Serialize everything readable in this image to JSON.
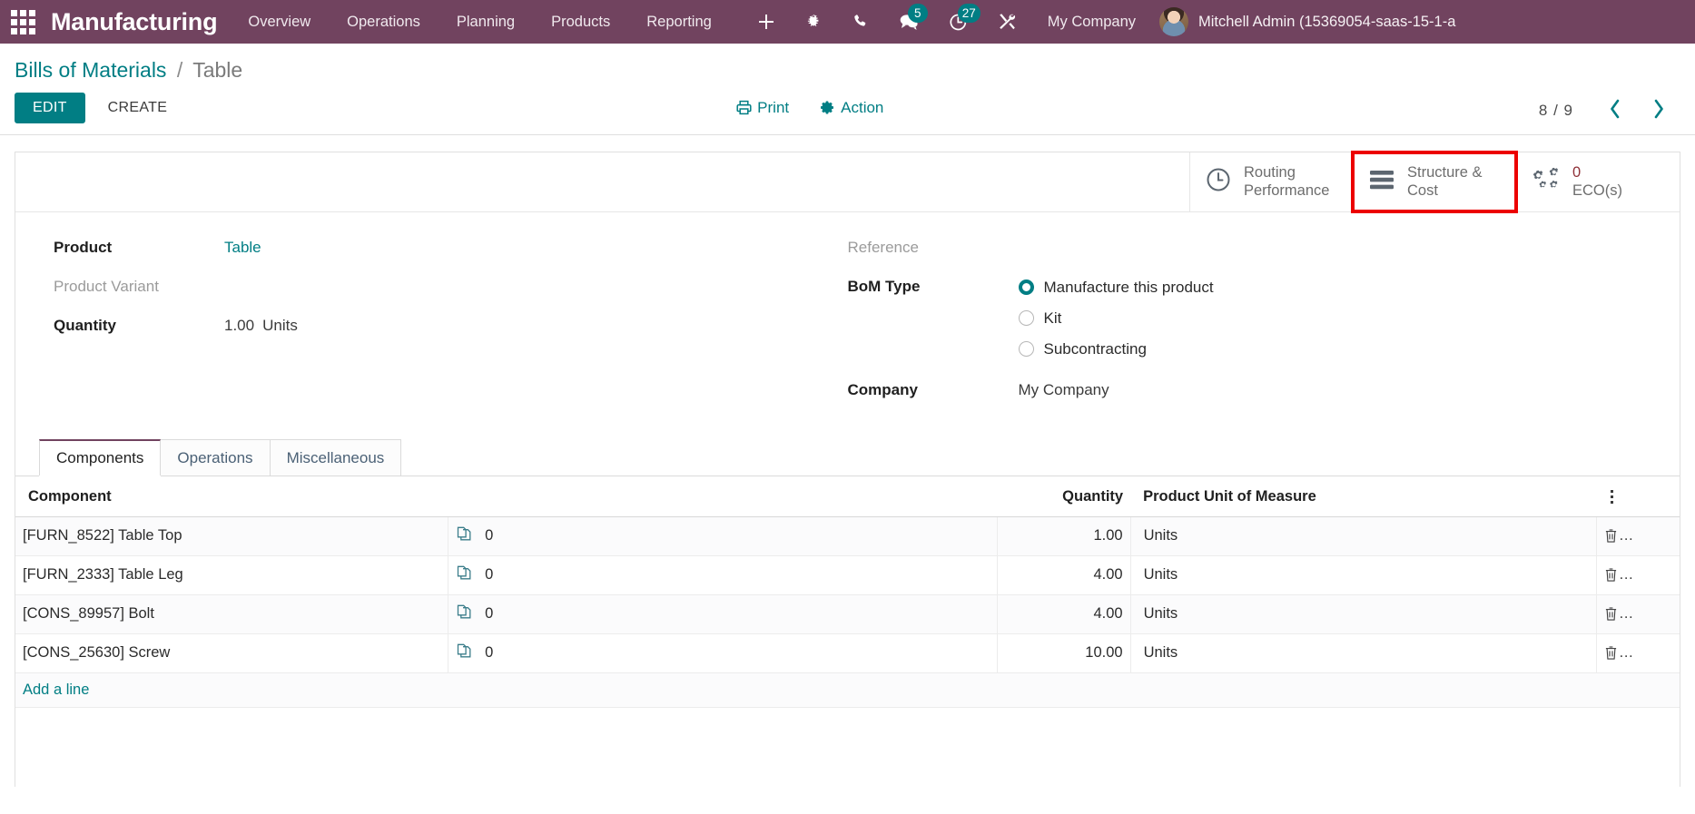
{
  "navbar": {
    "apps_icon": "apps-grid-icon",
    "brand": "Manufacturing",
    "menu": [
      {
        "label": "Overview"
      },
      {
        "label": "Operations"
      },
      {
        "label": "Planning"
      },
      {
        "label": "Products"
      },
      {
        "label": "Reporting"
      }
    ],
    "icons": [
      {
        "name": "plus-icon",
        "badge": ""
      },
      {
        "name": "bug-icon",
        "badge": ""
      },
      {
        "name": "phone-icon",
        "badge": ""
      },
      {
        "name": "chat-icon",
        "badge": "5"
      },
      {
        "name": "activity-clock-icon",
        "badge": "27"
      },
      {
        "name": "tools-icon",
        "badge": ""
      }
    ],
    "company": "My Company",
    "username": "Mitchell Admin (15369054-saas-15-1-a",
    "badge_chat": "5",
    "badge_activity": "27",
    "bg_color": "#71435f",
    "badge_color": "#017e84"
  },
  "control_panel": {
    "breadcrumb_root": "Bills of Materials",
    "breadcrumb_sep": "/",
    "breadcrumb_current": "Table",
    "edit_label": "EDIT",
    "create_label": "CREATE",
    "print_label": "Print",
    "action_label": "Action",
    "pager_text": "8 / 9",
    "pager_prev": "‹",
    "pager_next": "›",
    "accent_color": "#017e84"
  },
  "stat_buttons": [
    {
      "icon": "clock-icon",
      "line1": "Routing",
      "line2": "Performance",
      "value": null,
      "highlighted": false
    },
    {
      "icon": "bars-list-icon",
      "line1": "Structure &",
      "line2": "Cost",
      "value": null,
      "highlighted": true
    },
    {
      "icon": "gears-icon",
      "value": "0",
      "line2": "ECO(s)",
      "highlighted": false
    }
  ],
  "highlight_color": "#ec0000",
  "form": {
    "left": {
      "product_label": "Product",
      "product_value": "Table",
      "variant_label": "Product Variant",
      "variant_value": "",
      "quantity_label": "Quantity",
      "quantity_value": "1.00",
      "quantity_unit": "Units"
    },
    "right": {
      "reference_label": "Reference",
      "reference_value": "",
      "bom_type_label": "BoM Type",
      "bom_type_options": [
        {
          "label": "Manufacture this product",
          "selected": true
        },
        {
          "label": "Kit",
          "selected": false
        },
        {
          "label": "Subcontracting",
          "selected": false
        }
      ],
      "company_label": "Company",
      "company_value": "My Company"
    }
  },
  "notebook": {
    "tabs": [
      {
        "label": "Components",
        "active": true
      },
      {
        "label": "Operations",
        "active": false
      },
      {
        "label": "Miscellaneous",
        "active": false
      }
    ]
  },
  "components_table": {
    "headers": {
      "component": "Component",
      "attachments": "",
      "quantity": "Quantity",
      "uom": "Product Unit of Measure",
      "optional": "optional-columns-icon"
    },
    "rows": [
      {
        "component": "[FURN_8522] Table Top",
        "attach_count": "0",
        "quantity": "1.00",
        "uom": "Units",
        "delete": "…"
      },
      {
        "component": "[FURN_2333] Table Leg",
        "attach_count": "0",
        "quantity": "4.00",
        "uom": "Units",
        "delete": "…"
      },
      {
        "component": "[CONS_89957] Bolt",
        "attach_count": "0",
        "quantity": "4.00",
        "uom": "Units",
        "delete": "…"
      },
      {
        "component": "[CONS_25630] Screw",
        "attach_count": "0",
        "quantity": "10.00",
        "uom": "Units",
        "delete": "…"
      }
    ],
    "add_line_label": "Add a line"
  }
}
